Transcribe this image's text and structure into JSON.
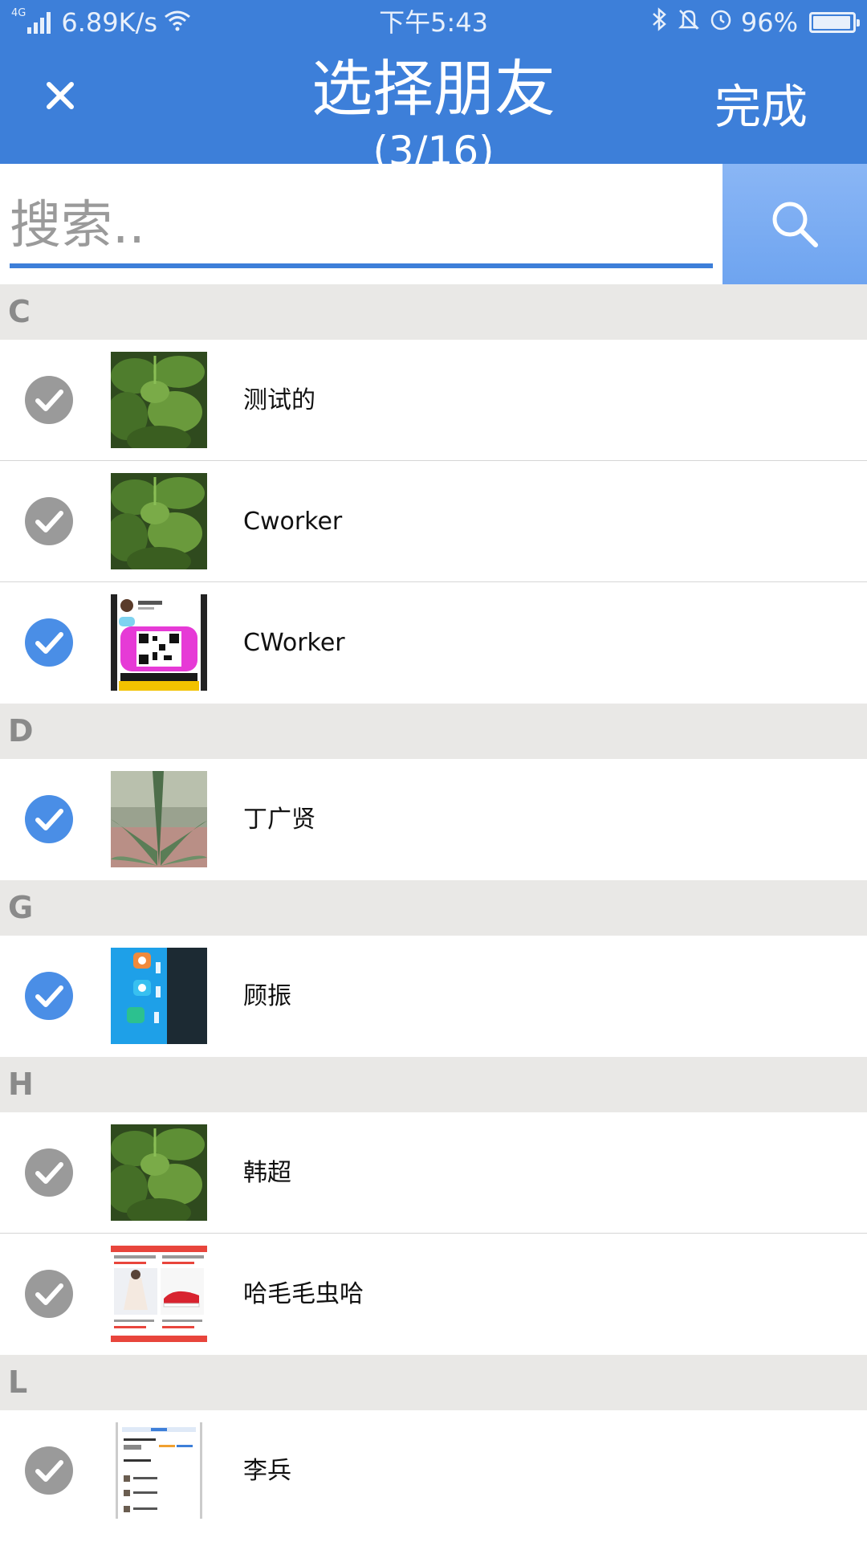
{
  "status_bar": {
    "network": "4G",
    "speed": "6.89K/s",
    "time": "下午5:43",
    "battery": "96%",
    "battery_level": 0.96,
    "icons": [
      "signal-icon",
      "wifi-icon",
      "bluetooth-icon",
      "mute-bell-icon",
      "alarm-icon",
      "battery-icon"
    ]
  },
  "header": {
    "title": "选择朋友",
    "subtitle": "(3/16)",
    "done_label": "完成",
    "close_icon": "close-icon"
  },
  "search": {
    "placeholder": "搜索..",
    "value": "",
    "button_icon": "search-icon"
  },
  "colors": {
    "accent": "#3d7fd9",
    "search_button": "#78abf2",
    "section_bg": "#e9e8e6",
    "checked": "#4a8ee6",
    "unchecked": "#9a9a9a"
  },
  "sections": [
    {
      "letter": "C",
      "contacts": [
        {
          "name": "测试的",
          "checked": false,
          "avatar": "plant-photo"
        },
        {
          "name": "Cworker",
          "checked": false,
          "avatar": "plant-photo"
        },
        {
          "name": "CWorker",
          "checked": true,
          "avatar": "qr-code-image"
        }
      ]
    },
    {
      "letter": "D",
      "contacts": [
        {
          "name": "丁广贤",
          "checked": true,
          "avatar": "aloe-photo"
        }
      ]
    },
    {
      "letter": "G",
      "contacts": [
        {
          "name": "顾振",
          "checked": true,
          "avatar": "phone-screen-photo"
        }
      ]
    },
    {
      "letter": "H",
      "contacts": [
        {
          "name": "韩超",
          "checked": false,
          "avatar": "plant-photo"
        },
        {
          "name": "哈毛毛虫哈",
          "checked": false,
          "avatar": "shopping-ad-image"
        }
      ]
    },
    {
      "letter": "L",
      "contacts": [
        {
          "name": "李兵",
          "checked": false,
          "avatar": "app-screenshot-image"
        }
      ]
    }
  ]
}
